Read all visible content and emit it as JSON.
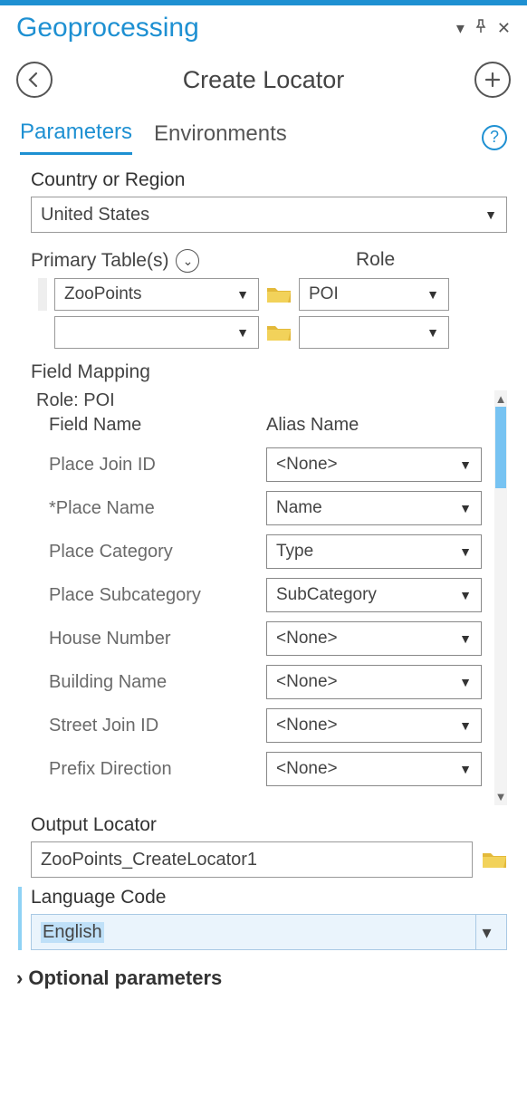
{
  "header": {
    "title": "Geoprocessing"
  },
  "tool": {
    "title": "Create Locator"
  },
  "tabs": {
    "parameters": "Parameters",
    "environments": "Environments"
  },
  "country": {
    "label": "Country or Region",
    "value": "United States"
  },
  "primary_tables": {
    "label": "Primary Table(s)",
    "role_label": "Role",
    "rows": [
      {
        "table": "ZooPoints",
        "role": "POI"
      },
      {
        "table": "",
        "role": ""
      }
    ]
  },
  "field_mapping": {
    "label": "Field Mapping",
    "role_line": "Role: POI",
    "col_field": "Field Name",
    "col_alias": "Alias Name",
    "rows": [
      {
        "field": "Place Join ID",
        "alias": "<None>"
      },
      {
        "field": "*Place Name",
        "alias": "Name"
      },
      {
        "field": "Place Category",
        "alias": "Type"
      },
      {
        "field": "Place Subcategory",
        "alias": "SubCategory"
      },
      {
        "field": "House Number",
        "alias": "<None>"
      },
      {
        "field": "Building Name",
        "alias": "<None>"
      },
      {
        "field": "Street Join ID",
        "alias": "<None>"
      },
      {
        "field": "Prefix Direction",
        "alias": "<None>"
      }
    ]
  },
  "output_locator": {
    "label": "Output Locator",
    "value": "ZooPoints_CreateLocator1"
  },
  "language": {
    "label": "Language Code",
    "value": "English"
  },
  "optional": {
    "label": "Optional parameters"
  }
}
